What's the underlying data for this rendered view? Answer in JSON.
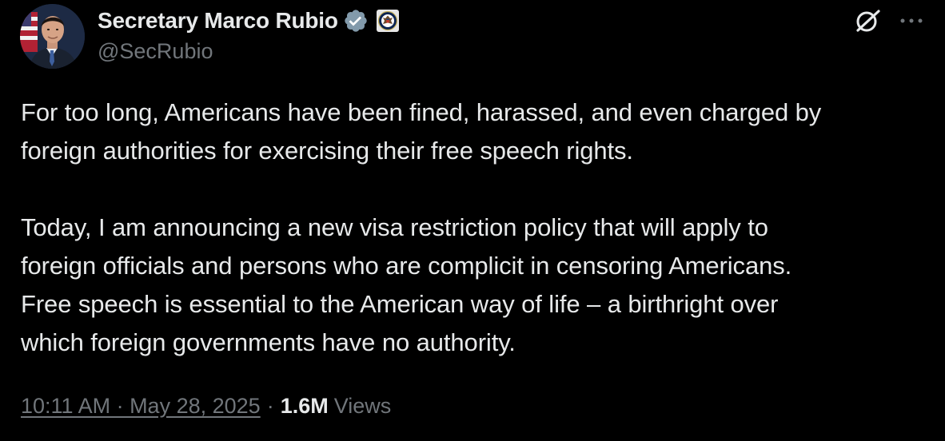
{
  "author": {
    "display_name": "Secretary Marco Rubio",
    "handle": "@SecRubio",
    "verified": true,
    "verified_color": "#829aab",
    "affiliation_badge": "state-department-seal"
  },
  "icons": {
    "grok": "grok-icon",
    "more": "more-options-icon"
  },
  "tweet": {
    "lines": [
      "For too long, Americans have been fined, harassed, and even charged by",
      "foreign authorities for exercising their free speech rights.",
      "",
      "Today, I am announcing a new visa restriction policy that will apply to",
      "foreign officials and persons who are complicit in censoring Americans.",
      "Free speech is essential to the American way of life – a birthright over",
      "which foreign governments have no authority."
    ]
  },
  "meta": {
    "timestamp": "10:11 AM · May 28, 2025",
    "separator": "·",
    "views_count": "1.6M",
    "views_label": "Views"
  },
  "colors": {
    "background": "#000000",
    "text_primary": "#e7e9ea",
    "text_secondary": "#71767b"
  }
}
